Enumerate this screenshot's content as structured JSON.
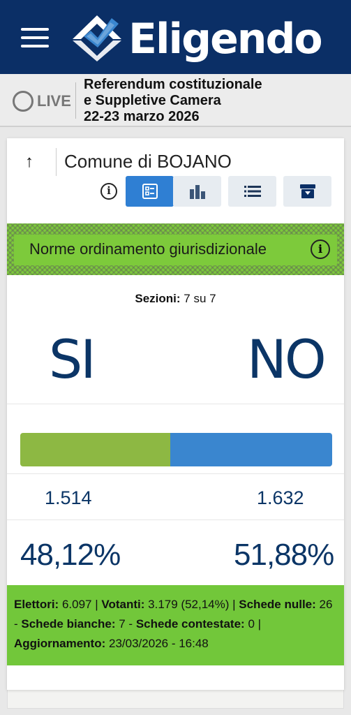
{
  "header": {
    "app_name": "Eligendo",
    "menu_icon": "hamburger-menu-icon",
    "logo_icon": "ballot-check-logo-icon",
    "colors": {
      "bar": "#0b2f66"
    }
  },
  "live": {
    "label": "LIVE",
    "election_line1": "Referendum costituzionale",
    "election_line2": "e Suppletive Camera",
    "election_line3": "22-23 marzo 2026"
  },
  "card": {
    "comune": "Comune di BOJANO",
    "toolbar": {
      "info_icon": "info-icon",
      "buttons": [
        {
          "icon": "cards-view-icon",
          "active": true
        },
        {
          "icon": "bar-chart-icon",
          "active": false
        },
        {
          "icon": "list-icon",
          "active": false
        },
        {
          "icon": "archive-icon",
          "active": false
        }
      ]
    },
    "topic": "Norme ordinamento giurisdizionale",
    "sezioni_label": "Sezioni:",
    "sezioni_value": "7 su 7",
    "si_label": "SI",
    "no_label": "NO",
    "si_votes": "1.514",
    "no_votes": "1.632",
    "si_pct": "48,12%",
    "no_pct": "51,88%",
    "si_share": 0.4812,
    "colors": {
      "si": "#8db843",
      "no": "#3a86cf",
      "summary": "#72c73a"
    },
    "summary": {
      "elettori_label": "Elettori:",
      "elettori_value": "6.097",
      "votanti_label": "Votanti:",
      "votanti_value": "3.179 (52,14%)",
      "nulle_label": "Schede nulle:",
      "nulle_value": "26",
      "bianche_label": "Schede bianche:",
      "bianche_value": "7",
      "contestate_label": "Schede contestate:",
      "contestate_value": "0",
      "aggiornamento_label": "Aggiornamento:",
      "aggiornamento_value": "23/03/2026 - 16:48"
    }
  }
}
